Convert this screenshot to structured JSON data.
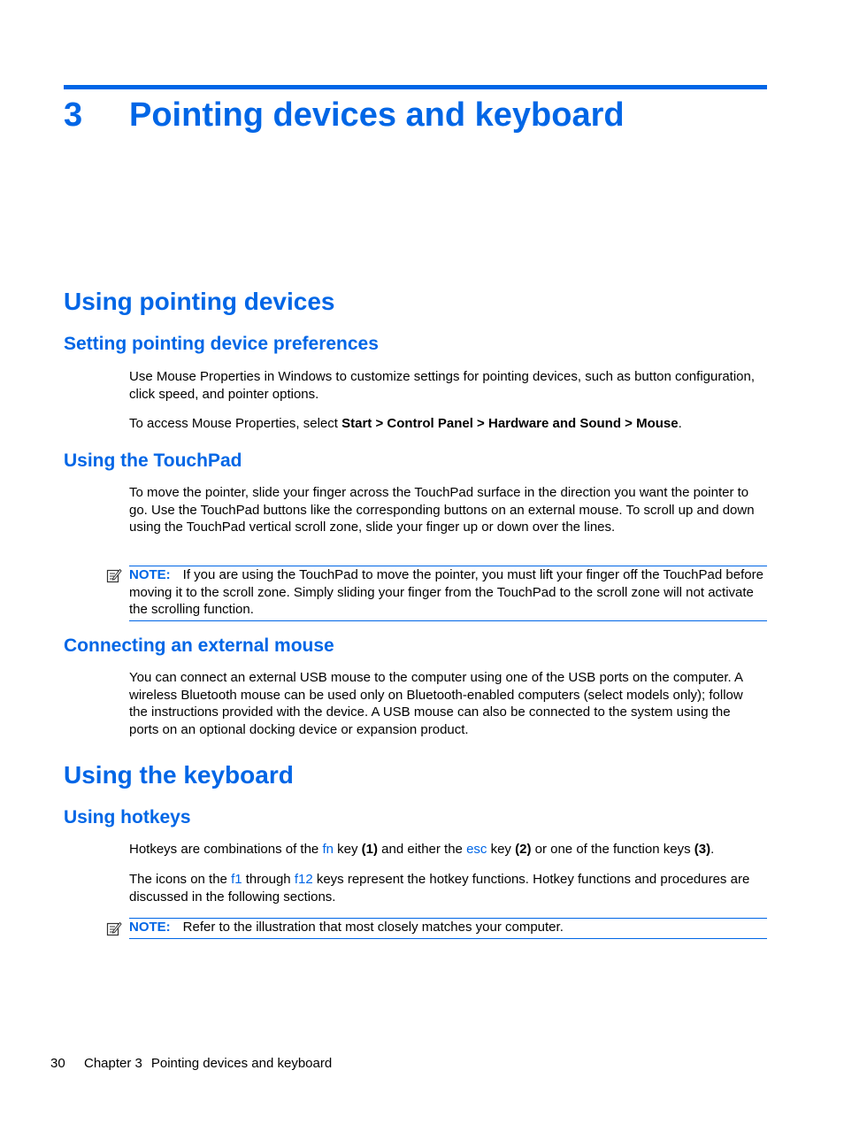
{
  "chapter": {
    "number": "3",
    "title": "Pointing devices and keyboard"
  },
  "sections": {
    "pointing": {
      "title": "Using pointing devices",
      "preferences": {
        "title": "Setting pointing device preferences",
        "p1": "Use Mouse Properties in Windows to customize settings for pointing devices, such as button configuration, click speed, and pointer options.",
        "p2_prefix": "To access Mouse Properties, select ",
        "p2_bold": "Start > Control Panel > Hardware and Sound > Mouse",
        "p2_suffix": "."
      },
      "touchpad": {
        "title": "Using the TouchPad",
        "p1": "To move the pointer, slide your finger across the TouchPad surface in the direction you want the pointer to go. Use the TouchPad buttons like the corresponding buttons on an external mouse. To scroll up and down using the TouchPad vertical scroll zone, slide your finger up or down over the lines.",
        "note_label": "NOTE:",
        "note_text": "If you are using the TouchPad to move the pointer, you must lift your finger off the TouchPad before moving it to the scroll zone. Simply sliding your finger from the TouchPad to the scroll zone will not activate the scrolling function."
      },
      "external_mouse": {
        "title": "Connecting an external mouse",
        "p1": "You can connect an external USB mouse to the computer using one of the USB ports on the computer. A wireless Bluetooth mouse can be used only on Bluetooth-enabled computers (select models only); follow the instructions provided with the device. A USB mouse can also be connected to the system using the ports on an optional docking device or expansion product."
      }
    },
    "keyboard": {
      "title": "Using the keyboard",
      "hotkeys": {
        "title": "Using hotkeys",
        "p1": {
          "t1": "Hotkeys are combinations of the ",
          "k1": "fn",
          "t2": " key ",
          "b1": "(1)",
          "t3": " and either the ",
          "k2": "esc",
          "t4": " key ",
          "b2": "(2)",
          "t5": " or one of the function keys ",
          "b3": "(3)",
          "t6": "."
        },
        "p2": {
          "t1": "The icons on the ",
          "k1": "f1",
          "t2": " through ",
          "k2": "f12",
          "t3": " keys represent the hotkey functions. Hotkey functions and procedures are discussed in the following sections."
        },
        "note_label": "NOTE:",
        "note_text": "Refer to the illustration that most closely matches your computer."
      }
    }
  },
  "footer": {
    "page_number": "30",
    "chapter_label": "Chapter 3",
    "chapter_title": "Pointing devices and keyboard"
  }
}
